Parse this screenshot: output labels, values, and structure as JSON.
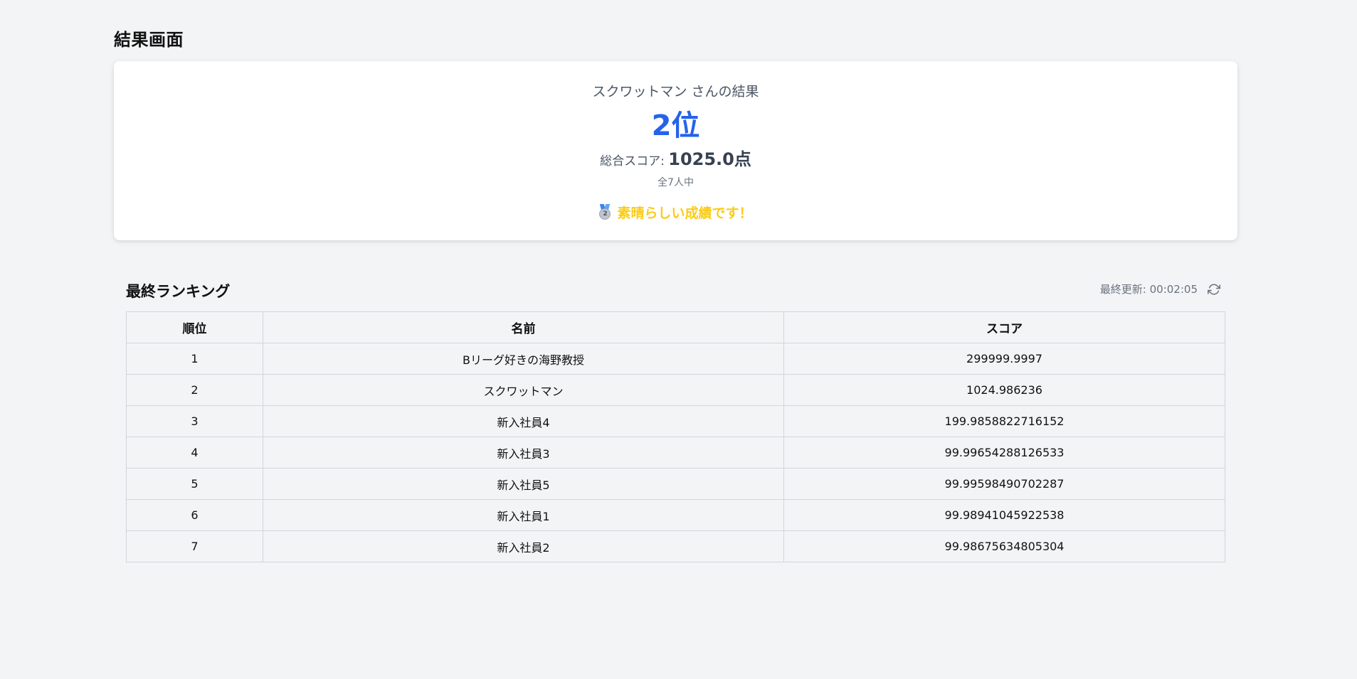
{
  "page": {
    "title": "結果画面"
  },
  "result": {
    "name_line": "スクワットマン さんの結果",
    "rank": "2位",
    "score_label": "総合スコア: ",
    "score_value": "1025.0点",
    "total": "全7人中",
    "medal_icon": "second-place-medal-icon",
    "message": "素晴らしい成績です！",
    "accent_color": "#2563eb",
    "message_color": "#facc15"
  },
  "ranking": {
    "title": "最終ランキング",
    "last_updated": "最終更新: 00:02:05",
    "refresh_icon": "refresh-icon",
    "columns": [
      "順位",
      "名前",
      "スコア"
    ],
    "rows": [
      {
        "rank": "1",
        "name": "Bリーグ好きの海野教授",
        "score": "299999.9997"
      },
      {
        "rank": "2",
        "name": "スクワットマン",
        "score": "1024.986236"
      },
      {
        "rank": "3",
        "name": "新入社員4",
        "score": "199.9858822716152"
      },
      {
        "rank": "4",
        "name": "新入社員3",
        "score": "99.99654288126533"
      },
      {
        "rank": "5",
        "name": "新入社員5",
        "score": "99.99598490702287"
      },
      {
        "rank": "6",
        "name": "新入社員1",
        "score": "99.98941045922538"
      },
      {
        "rank": "7",
        "name": "新入社員2",
        "score": "99.98675634805304"
      }
    ]
  }
}
